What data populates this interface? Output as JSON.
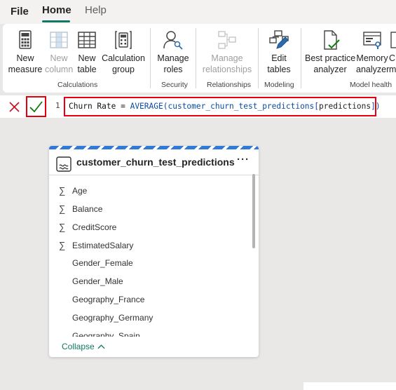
{
  "menubar": {
    "file": "File",
    "home": "Home",
    "help": "Help"
  },
  "ribbon": {
    "buttons": [
      {
        "line1": "New",
        "line2": "measure",
        "icon": "calculator-icon"
      },
      {
        "line1": "New",
        "line2": "column",
        "icon": "new-column-icon"
      },
      {
        "line1": "New",
        "line2": "table",
        "icon": "new-table-icon"
      },
      {
        "line1": "Calculation",
        "line2": "group",
        "icon": "calculation-group-icon"
      },
      {
        "line1": "Manage",
        "line2": "roles",
        "icon": "manage-roles-icon"
      },
      {
        "line1": "Manage",
        "line2": "relationships",
        "icon": "relationships-icon"
      },
      {
        "line1": "Edit",
        "line2": "tables",
        "icon": "edit-tables-icon"
      },
      {
        "line1": "Best practice",
        "line2": "analyzer",
        "icon": "best-practice-icon"
      },
      {
        "line1": "Memory",
        "line2": "analyzer",
        "icon": "memory-analyzer-icon"
      },
      {
        "line1": "C",
        "line2": "m",
        "icon": "truncated-icon"
      }
    ],
    "groups": [
      "Calculations",
      "Security",
      "Relationships",
      "Modeling",
      "Model health"
    ]
  },
  "formula": {
    "line_number": "1",
    "measure_name": "Churn Rate",
    "operator": " = ",
    "function": "AVERAGE",
    "table": "customer_churn_test_predictions",
    "column": "predictions"
  },
  "table_card": {
    "title": "customer_churn_test_predictions",
    "more": "···",
    "fields": [
      {
        "name": "Age",
        "sigma": true
      },
      {
        "name": "Balance",
        "sigma": true
      },
      {
        "name": "CreditScore",
        "sigma": true
      },
      {
        "name": "EstimatedSalary",
        "sigma": true
      },
      {
        "name": "Gender_Female",
        "sigma": false
      },
      {
        "name": "Gender_Male",
        "sigma": false
      },
      {
        "name": "Geography_France",
        "sigma": false
      },
      {
        "name": "Geography_Germany",
        "sigma": false
      },
      {
        "name": "Geography_Spain",
        "sigma": false
      }
    ],
    "sigma_symbol": "∑",
    "collapse_label": "Collapse"
  },
  "colors": {
    "accent": "#117865",
    "highlight": "#e3000f",
    "dax_function": "#0a4da3"
  }
}
